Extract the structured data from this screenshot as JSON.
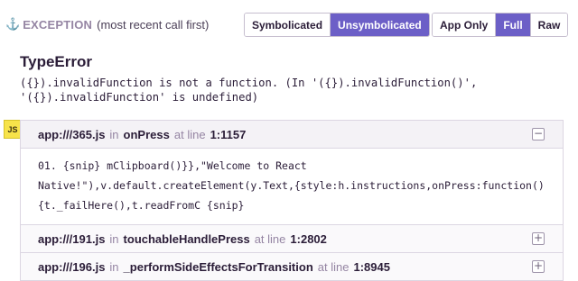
{
  "header": {
    "anchor_icon": "anchor-icon",
    "title": "EXCEPTION",
    "subtitle": "(most recent call first)"
  },
  "view_toggle": {
    "symbolicated": "Symbolicated",
    "unsymbolicated": "Unsymbolicated",
    "active": "Unsymbolicated"
  },
  "scope_toggle": {
    "app_only": "App Only",
    "full": "Full",
    "raw": "Raw",
    "active": "Full"
  },
  "error": {
    "type": "TypeError",
    "message": "({}).invalidFunction is not a function. (In '({}).invalidFunction()',\n'({}).invalidFunction' is undefined)"
  },
  "platform_badge": "JS",
  "frames": [
    {
      "file": "app:///365.js",
      "in": "in",
      "function": "onPress",
      "at_line": "at line",
      "line": "1:1157",
      "toggle": "−",
      "expanded": true,
      "code": "01. {snip} mClipboard()}},\"Welcome to React\nNative!\"),v.default.createElement(y.Text,{style:h.instructions,onPress:function()\n{t._failHere(),t.readFromC {snip}"
    },
    {
      "file": "app:///191.js",
      "in": "in",
      "function": "touchableHandlePress",
      "at_line": "at line",
      "line": "1:2802",
      "toggle": "+",
      "expanded": false
    },
    {
      "file": "app:///196.js",
      "in": "in",
      "function": "_performSideEffectsForTransition",
      "at_line": "at line",
      "line": "1:8945",
      "toggle": "+",
      "expanded": false
    }
  ],
  "colors": {
    "accent": "#6c5fc7",
    "badge": "#f7e34a"
  }
}
